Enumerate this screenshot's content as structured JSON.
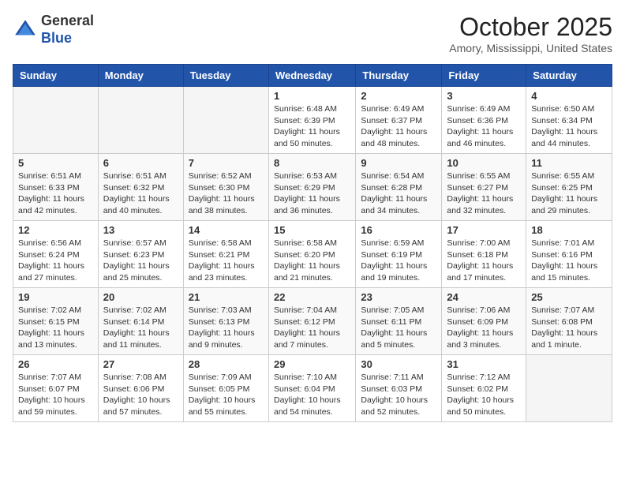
{
  "header": {
    "logo": {
      "general": "General",
      "blue": "Blue"
    },
    "month": "October 2025",
    "location": "Amory, Mississippi, United States"
  },
  "weekdays": [
    "Sunday",
    "Monday",
    "Tuesday",
    "Wednesday",
    "Thursday",
    "Friday",
    "Saturday"
  ],
  "weeks": [
    [
      {
        "day": "",
        "info": ""
      },
      {
        "day": "",
        "info": ""
      },
      {
        "day": "",
        "info": ""
      },
      {
        "day": "1",
        "info": "Sunrise: 6:48 AM\nSunset: 6:39 PM\nDaylight: 11 hours\nand 50 minutes."
      },
      {
        "day": "2",
        "info": "Sunrise: 6:49 AM\nSunset: 6:37 PM\nDaylight: 11 hours\nand 48 minutes."
      },
      {
        "day": "3",
        "info": "Sunrise: 6:49 AM\nSunset: 6:36 PM\nDaylight: 11 hours\nand 46 minutes."
      },
      {
        "day": "4",
        "info": "Sunrise: 6:50 AM\nSunset: 6:34 PM\nDaylight: 11 hours\nand 44 minutes."
      }
    ],
    [
      {
        "day": "5",
        "info": "Sunrise: 6:51 AM\nSunset: 6:33 PM\nDaylight: 11 hours\nand 42 minutes."
      },
      {
        "day": "6",
        "info": "Sunrise: 6:51 AM\nSunset: 6:32 PM\nDaylight: 11 hours\nand 40 minutes."
      },
      {
        "day": "7",
        "info": "Sunrise: 6:52 AM\nSunset: 6:30 PM\nDaylight: 11 hours\nand 38 minutes."
      },
      {
        "day": "8",
        "info": "Sunrise: 6:53 AM\nSunset: 6:29 PM\nDaylight: 11 hours\nand 36 minutes."
      },
      {
        "day": "9",
        "info": "Sunrise: 6:54 AM\nSunset: 6:28 PM\nDaylight: 11 hours\nand 34 minutes."
      },
      {
        "day": "10",
        "info": "Sunrise: 6:55 AM\nSunset: 6:27 PM\nDaylight: 11 hours\nand 32 minutes."
      },
      {
        "day": "11",
        "info": "Sunrise: 6:55 AM\nSunset: 6:25 PM\nDaylight: 11 hours\nand 29 minutes."
      }
    ],
    [
      {
        "day": "12",
        "info": "Sunrise: 6:56 AM\nSunset: 6:24 PM\nDaylight: 11 hours\nand 27 minutes."
      },
      {
        "day": "13",
        "info": "Sunrise: 6:57 AM\nSunset: 6:23 PM\nDaylight: 11 hours\nand 25 minutes."
      },
      {
        "day": "14",
        "info": "Sunrise: 6:58 AM\nSunset: 6:21 PM\nDaylight: 11 hours\nand 23 minutes."
      },
      {
        "day": "15",
        "info": "Sunrise: 6:58 AM\nSunset: 6:20 PM\nDaylight: 11 hours\nand 21 minutes."
      },
      {
        "day": "16",
        "info": "Sunrise: 6:59 AM\nSunset: 6:19 PM\nDaylight: 11 hours\nand 19 minutes."
      },
      {
        "day": "17",
        "info": "Sunrise: 7:00 AM\nSunset: 6:18 PM\nDaylight: 11 hours\nand 17 minutes."
      },
      {
        "day": "18",
        "info": "Sunrise: 7:01 AM\nSunset: 6:16 PM\nDaylight: 11 hours\nand 15 minutes."
      }
    ],
    [
      {
        "day": "19",
        "info": "Sunrise: 7:02 AM\nSunset: 6:15 PM\nDaylight: 11 hours\nand 13 minutes."
      },
      {
        "day": "20",
        "info": "Sunrise: 7:02 AM\nSunset: 6:14 PM\nDaylight: 11 hours\nand 11 minutes."
      },
      {
        "day": "21",
        "info": "Sunrise: 7:03 AM\nSunset: 6:13 PM\nDaylight: 11 hours\nand 9 minutes."
      },
      {
        "day": "22",
        "info": "Sunrise: 7:04 AM\nSunset: 6:12 PM\nDaylight: 11 hours\nand 7 minutes."
      },
      {
        "day": "23",
        "info": "Sunrise: 7:05 AM\nSunset: 6:11 PM\nDaylight: 11 hours\nand 5 minutes."
      },
      {
        "day": "24",
        "info": "Sunrise: 7:06 AM\nSunset: 6:09 PM\nDaylight: 11 hours\nand 3 minutes."
      },
      {
        "day": "25",
        "info": "Sunrise: 7:07 AM\nSunset: 6:08 PM\nDaylight: 11 hours\nand 1 minute."
      }
    ],
    [
      {
        "day": "26",
        "info": "Sunrise: 7:07 AM\nSunset: 6:07 PM\nDaylight: 10 hours\nand 59 minutes."
      },
      {
        "day": "27",
        "info": "Sunrise: 7:08 AM\nSunset: 6:06 PM\nDaylight: 10 hours\nand 57 minutes."
      },
      {
        "day": "28",
        "info": "Sunrise: 7:09 AM\nSunset: 6:05 PM\nDaylight: 10 hours\nand 55 minutes."
      },
      {
        "day": "29",
        "info": "Sunrise: 7:10 AM\nSunset: 6:04 PM\nDaylight: 10 hours\nand 54 minutes."
      },
      {
        "day": "30",
        "info": "Sunrise: 7:11 AM\nSunset: 6:03 PM\nDaylight: 10 hours\nand 52 minutes."
      },
      {
        "day": "31",
        "info": "Sunrise: 7:12 AM\nSunset: 6:02 PM\nDaylight: 10 hours\nand 50 minutes."
      },
      {
        "day": "",
        "info": ""
      }
    ]
  ]
}
